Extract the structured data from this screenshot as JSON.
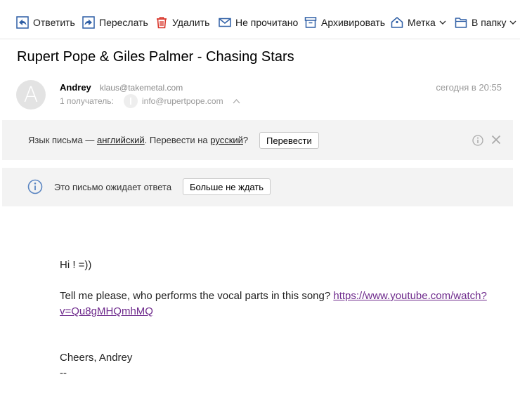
{
  "toolbar": {
    "reply": "Ответить",
    "forward": "Переслать",
    "delete": "Удалить",
    "unread": "Не прочитано",
    "archive": "Архивировать",
    "label": "Метка",
    "to_folder": "В папку"
  },
  "message": {
    "subject": "Rupert Pope & Giles Palmer - Chasing Stars",
    "avatar_letter": "A",
    "sender_name": "Andrey",
    "sender_email": "klaus@takemetal.com",
    "date": "сегодня в 20:55",
    "recipients_label": "1 получатель:",
    "recipient_email": "info@rupertpope.com"
  },
  "translate": {
    "prefix": "Язык письма — ",
    "source_lang": "английский",
    "middle": ". Перевести на ",
    "target_lang": "русский",
    "suffix": "?",
    "button": "Перевести"
  },
  "await": {
    "text": "Это письмо ожидает ответа",
    "button": "Больше не ждать"
  },
  "body": {
    "greeting": "Hi ! =))",
    "question": "Tell me please, who performs the vocal parts in this song? ",
    "link_line1": "https://www.youtube.com/watch?",
    "link_line2": "v=Qu8gMHQmhMQ",
    "signoff": "Cheers, Andrey",
    "sig_sep": "--"
  },
  "colors": {
    "icon_blue": "#2f5fa5",
    "delete_red": "#d9362b",
    "bar_bg": "#f3f3f3",
    "link_purple": "#6e2a8c"
  }
}
